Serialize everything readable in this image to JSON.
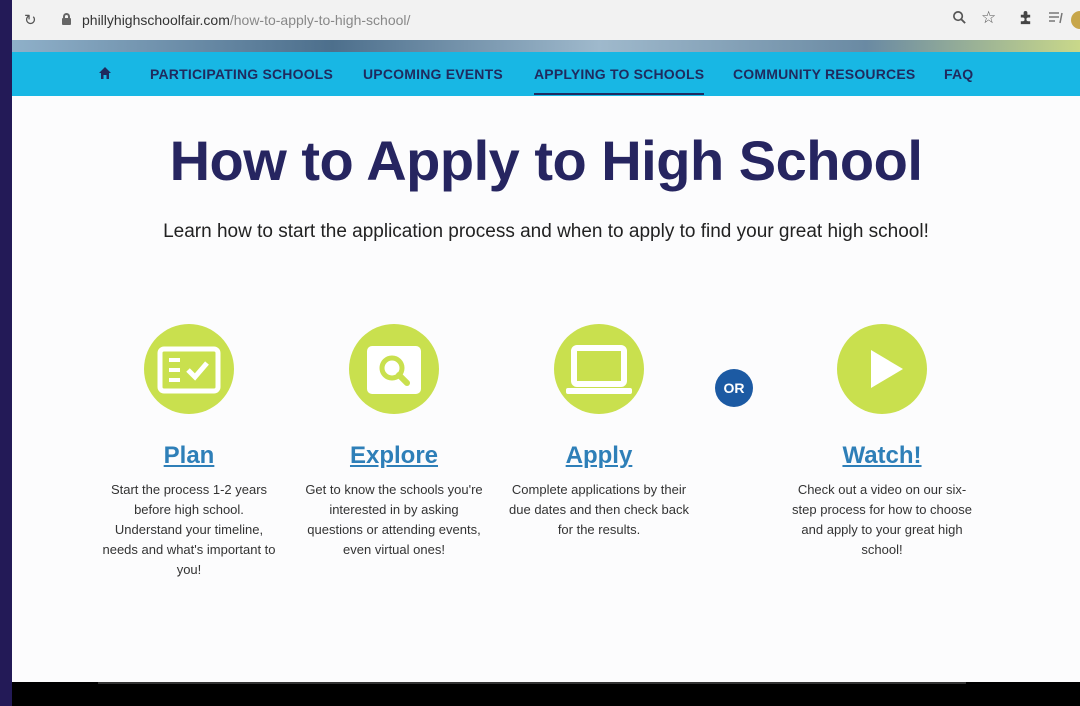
{
  "browser": {
    "domain": "phillyhighschoolfair.com",
    "path": "/how-to-apply-to-high-school/"
  },
  "nav": {
    "items": [
      {
        "label": "PARTICIPATING SCHOOLS"
      },
      {
        "label": "UPCOMING EVENTS"
      },
      {
        "label": "APPLYING TO SCHOOLS",
        "active": true
      },
      {
        "label": "COMMUNITY RESOURCES"
      },
      {
        "label": "FAQ"
      }
    ]
  },
  "main": {
    "title": "How to Apply to High School",
    "subtitle": "Learn how to start the application process and when to apply to find your great high school!",
    "or_label": "OR",
    "steps": [
      {
        "label": "Plan",
        "icon": "checklist-icon",
        "description": "Start the process 1-2 years before high school. Understand your timeline, needs and what's important to you!"
      },
      {
        "label": "Explore",
        "icon": "magnifier-icon",
        "description": "Get to know the schools you're interested in by asking questions or attending events, even virtual ones!"
      },
      {
        "label": "Apply",
        "icon": "laptop-icon",
        "description": "Complete applications by their due dates and then check back for the results."
      },
      {
        "label": "Watch!",
        "icon": "play-icon",
        "description": "Check out a video on our six-step process for how to choose and apply to your great high school!"
      }
    ]
  },
  "colors": {
    "nav_bg": "#18b7e4",
    "title": "#262560",
    "accent_green": "#c9e04e",
    "link_blue": "#2e7fb8",
    "or_badge": "#1c5aa3"
  }
}
